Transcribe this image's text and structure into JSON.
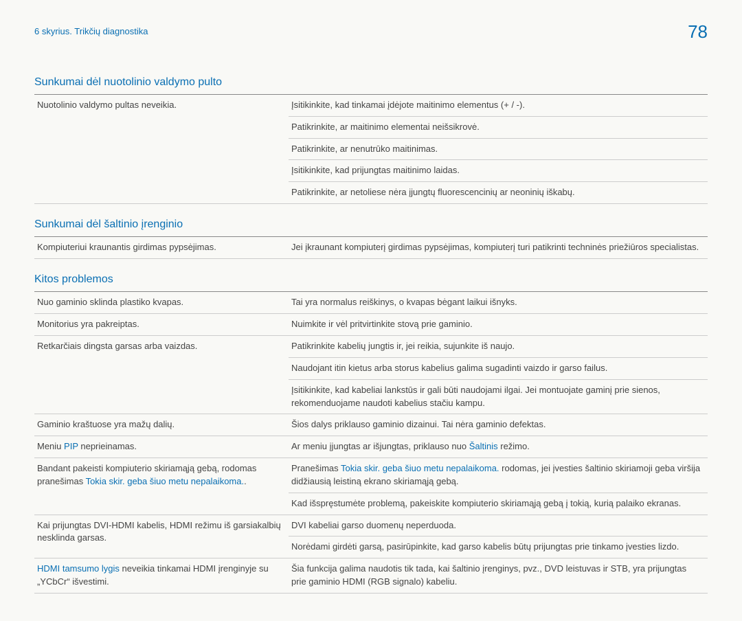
{
  "header": {
    "chapter": "6 skyrius. Trikčių diagnostika",
    "pageno": "78"
  },
  "section1": {
    "title": "Sunkumai dėl nuotolinio valdymo pulto",
    "rows": [
      {
        "l": "Nuotolinio valdymo pultas neveikia.",
        "r": "Įsitikinkite, kad tinkamai įdėjote maitinimo elementus (+ / -)."
      },
      {
        "l": "",
        "r": "Patikrinkite, ar maitinimo elementai neišsikrovė."
      },
      {
        "l": "",
        "r": "Patikrinkite, ar nenutrūko maitinimas."
      },
      {
        "l": "",
        "r": "Įsitikinkite, kad prijungtas maitinimo laidas."
      },
      {
        "l": "",
        "r": "Patikrinkite, ar netoliese nėra įjungtų fluorescencinių ar neoninių iškabų."
      }
    ]
  },
  "section2": {
    "title": "Sunkumai dėl šaltinio įrenginio",
    "rows": [
      {
        "l": "Kompiuteriui kraunantis girdimas pypsėjimas.",
        "r": "Jei įkraunant kompiuterį girdimas pypsėjimas, kompiuterį turi patikrinti techninės priežiūros specialistas."
      }
    ]
  },
  "section3": {
    "title": "Kitos problemos",
    "rows": {
      "r1l": "Nuo gaminio sklinda plastiko kvapas.",
      "r1r": "Tai yra normalus reiškinys, o kvapas bėgant laikui išnyks.",
      "r2l": "Monitorius yra pakreiptas.",
      "r2r": "Nuimkite ir vėl pritvirtinkite stovą prie gaminio.",
      "r3l": "Retkarčiais dingsta garsas arba vaizdas.",
      "r3r": "Patikrinkite kabelių jungtis ir, jei reikia, sujunkite iš naujo.",
      "r4r": "Naudojant itin kietus arba storus kabelius galima sugadinti vaizdo ir garso failus.",
      "r5r": "Įsitikinkite, kad kabeliai lankstūs ir gali būti naudojami ilgai. Jei montuojate gaminį prie sienos, rekomenduojame naudoti kabelius stačiu kampu.",
      "r6l": "Gaminio kraštuose yra mažų dalių.",
      "r6r": "Šios dalys priklauso gaminio dizainui. Tai nėra gaminio defektas.",
      "r7l_a": "Meniu ",
      "r7l_b": "PIP",
      "r7l_c": " neprieinamas.",
      "r7r_a": "Ar meniu įjungtas ar išjungtas, priklauso nuo ",
      "r7r_b": "Šaltinis",
      "r7r_c": " režimo.",
      "r8l_a": "Bandant pakeisti kompiuterio skiriamąją gebą, rodomas pranešimas ",
      "r8l_b": "Tokia skir. geba šiuo metu nepalaikoma.",
      "r8l_c": ".",
      "r8r_a": "Pranešimas ",
      "r8r_b": "Tokia skir. geba šiuo metu nepalaikoma.",
      "r8r_c": " rodomas, jei įvesties šaltinio skiriamoji geba viršija didžiausią leistiną ekrano skiriamąją gebą.",
      "r9r": "Kad išspręstumėte problemą, pakeiskite kompiuterio skiriamąją gebą į tokią, kurią palaiko ekranas.",
      "r10l": "Kai prijungtas DVI-HDMI kabelis, HDMI režimu iš garsiakalbių nesklinda garsas.",
      "r10r": "DVI kabeliai garso duomenų neperduoda.",
      "r11r": "Norėdami girdėti garsą, pasirūpinkite, kad garso kabelis būtų prijungtas prie tinkamo įvesties lizdo.",
      "r12l_a": "HDMI tamsumo lygis",
      "r12l_b": " neveikia tinkamai HDMI įrenginyje su „YCbCr“ išvestimi.",
      "r12r": "Šia funkcija galima naudotis tik tada, kai šaltinio įrenginys, pvz., DVD leistuvas ir STB, yra prijungtas prie gaminio HDMI (RGB signalo) kabeliu."
    }
  }
}
